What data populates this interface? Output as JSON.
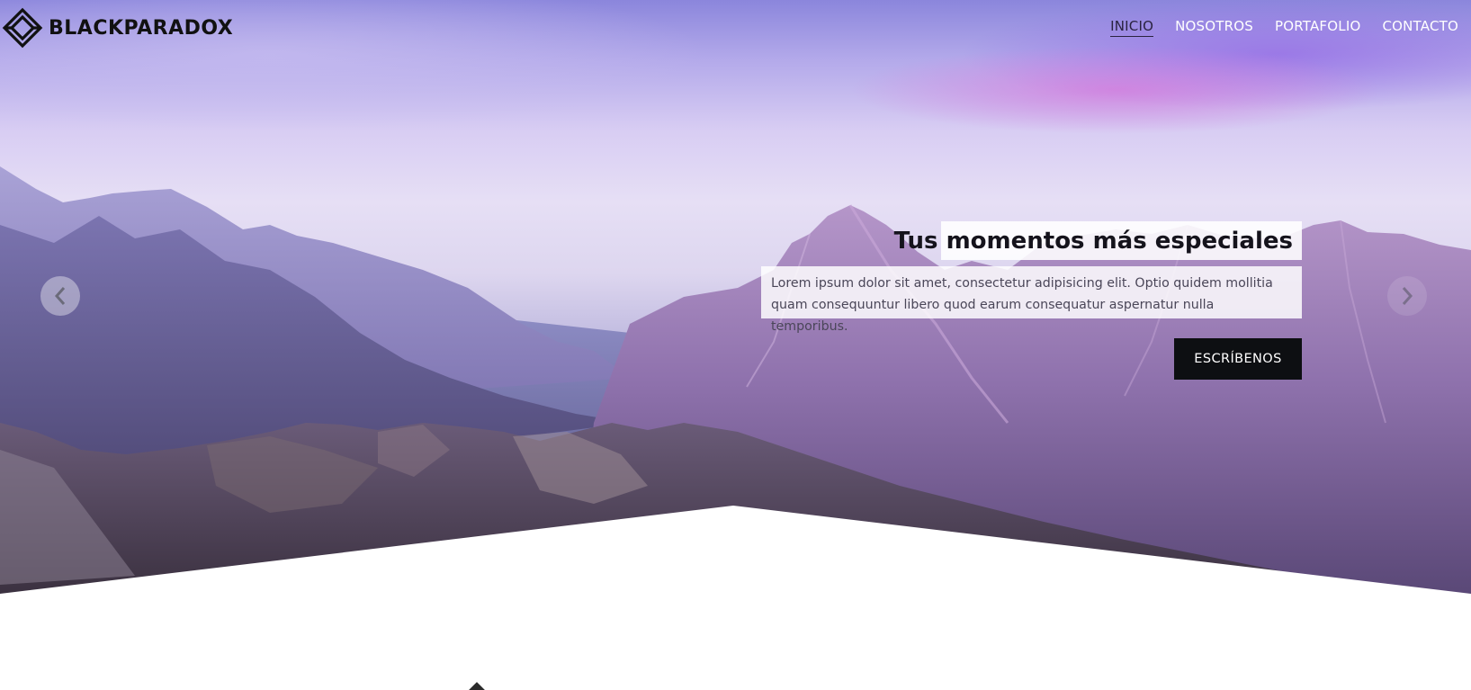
{
  "header": {
    "brand": "BLACKPARADOX",
    "logo_icon": "paradox-diamond-logo-icon",
    "nav": [
      {
        "label": "INICIO",
        "active": true
      },
      {
        "label": "NOSOTROS",
        "active": false
      },
      {
        "label": "PORTAFOLIO",
        "active": false
      },
      {
        "label": "CONTACTO",
        "active": false
      }
    ]
  },
  "hero": {
    "title": "Tus momentos más especiales",
    "text": "Lorem ipsum dolor sit amet, consectetur adipisicing elit. Optio quidem mollitia quam consequuntur libero quod earum consequatur aspernatur nulla temporibus.",
    "cta_label": "ESCRÍBENOS",
    "prev_icon": "chevron-left-icon",
    "next_icon": "chevron-right-icon"
  },
  "colors": {
    "cta_background": "#0d0f12",
    "nav_text": "#ffffff",
    "nav_active": "#2a2340",
    "brand_text": "#111111"
  }
}
